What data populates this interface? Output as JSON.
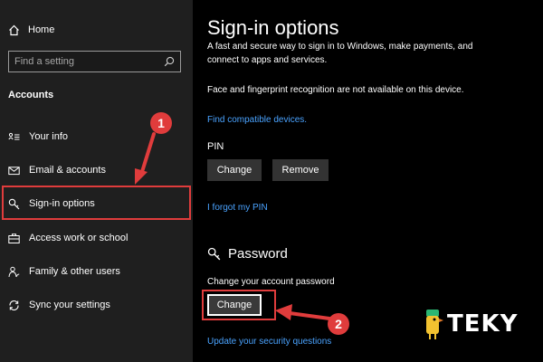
{
  "sidebar": {
    "home_label": "Home",
    "search_placeholder": "Find a setting",
    "section_title": "Accounts",
    "items": [
      {
        "label": "Your info",
        "icon": "person-card-icon"
      },
      {
        "label": "Email & accounts",
        "icon": "mail-icon"
      },
      {
        "label": "Sign-in options",
        "icon": "key-icon",
        "selected": true
      },
      {
        "label": "Access work or school",
        "icon": "briefcase-icon"
      },
      {
        "label": "Family & other users",
        "icon": "people-icon"
      },
      {
        "label": "Sync your settings",
        "icon": "sync-icon"
      }
    ]
  },
  "main": {
    "title": "Sign-in options",
    "intro": "A fast and secure way to sign in to Windows, make payments, and connect to apps and services.",
    "face_message": "Face and fingerprint recognition are not available on this device.",
    "find_devices_link": "Find compatible devices.",
    "pin": {
      "label": "PIN",
      "change_label": "Change",
      "remove_label": "Remove",
      "forgot_link": "I forgot my PIN"
    },
    "password": {
      "title": "Password",
      "description": "Change your account password",
      "change_label": "Change",
      "security_link": "Update your security questions"
    }
  },
  "annotations": {
    "step1": "1",
    "step2": "2",
    "color": "#e03c3c"
  },
  "logo": {
    "text": "TEKY",
    "accent_colors": [
      "#f2c230",
      "#2bb673"
    ]
  }
}
